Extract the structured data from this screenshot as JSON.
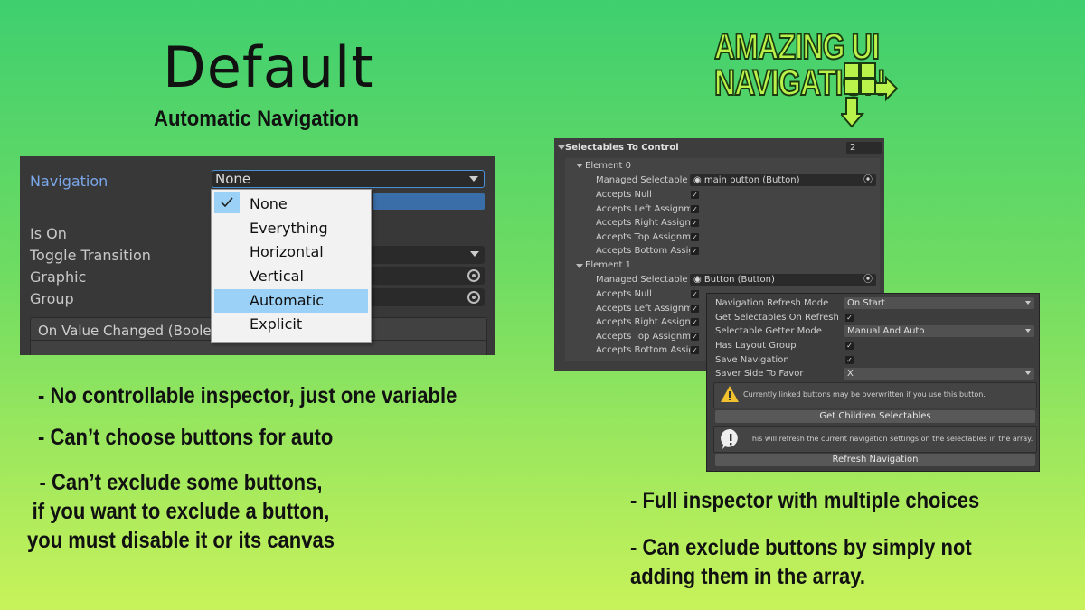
{
  "left": {
    "title": "Default",
    "subtitle": "Automatic Navigation",
    "inspector": {
      "navigation_label": "Navigation",
      "navigation_value": "None",
      "is_on_label": "Is On",
      "toggle_transition_label": "Toggle Transition",
      "graphic_label": "Graphic",
      "group_label": "Group",
      "on_value_changed": "On Value Changed (Boolean"
    },
    "menu": {
      "items": [
        "None",
        "Everything",
        "Horizontal",
        "Vertical",
        "Automatic",
        "Explicit"
      ],
      "checked": "None",
      "highlighted": "Automatic"
    },
    "bullets": [
      "- No controllable inspector, just one variable",
      "- Can’t choose buttons for auto"
    ],
    "bullet3": [
      "- Can’t exclude some buttons,",
      "if you want to exclude a button,",
      "you must disable it or its canvas"
    ]
  },
  "right": {
    "logo": {
      "line1": "AMAZING UI",
      "line2": "NAVIGATION"
    },
    "array": {
      "header": "Selectables To Control",
      "size": "2",
      "elements": [
        {
          "title": "Element 0",
          "managed_label": "Managed Selectable",
          "managed_value": "main button (Button)",
          "rows": [
            "Accepts Null",
            "Accepts Left Assignmen",
            "Accepts Right Assignme",
            "Accepts Top Assignmen",
            "Accepts Bottom Assignm"
          ]
        },
        {
          "title": "Element 1",
          "managed_label": "Managed Selectable",
          "managed_value": "Button (Button)",
          "rows": [
            "Accepts Null",
            "Accepts Left Assignmen",
            "Accepts Right Assignme",
            "Accepts Top Assignmen",
            "Accepts Bottom Assignm"
          ]
        }
      ]
    },
    "settings": {
      "refresh_mode_label": "Navigation Refresh Mode",
      "refresh_mode_value": "On Start",
      "get_on_refresh_label": "Get Selectables On Refresh",
      "getter_mode_label": "Selectable Getter Mode",
      "getter_mode_value": "Manual And Auto",
      "has_layout_label": "Has Layout Group",
      "save_nav_label": "Save Navigation",
      "saver_side_label": "Saver Side To Favor",
      "saver_side_value": "X",
      "warning": "Currently linked buttons may be overwritten if you use this button.",
      "get_children_button": "Get Children Selectables",
      "info": "This will refresh the current navigation settings on the selectables in the array.",
      "refresh_button": "Refresh Navigation"
    },
    "bullets": [
      "- Full inspector with multiple choices"
    ],
    "bullet2": [
      "- Can exclude buttons by simply not",
      "adding them in the array."
    ]
  }
}
